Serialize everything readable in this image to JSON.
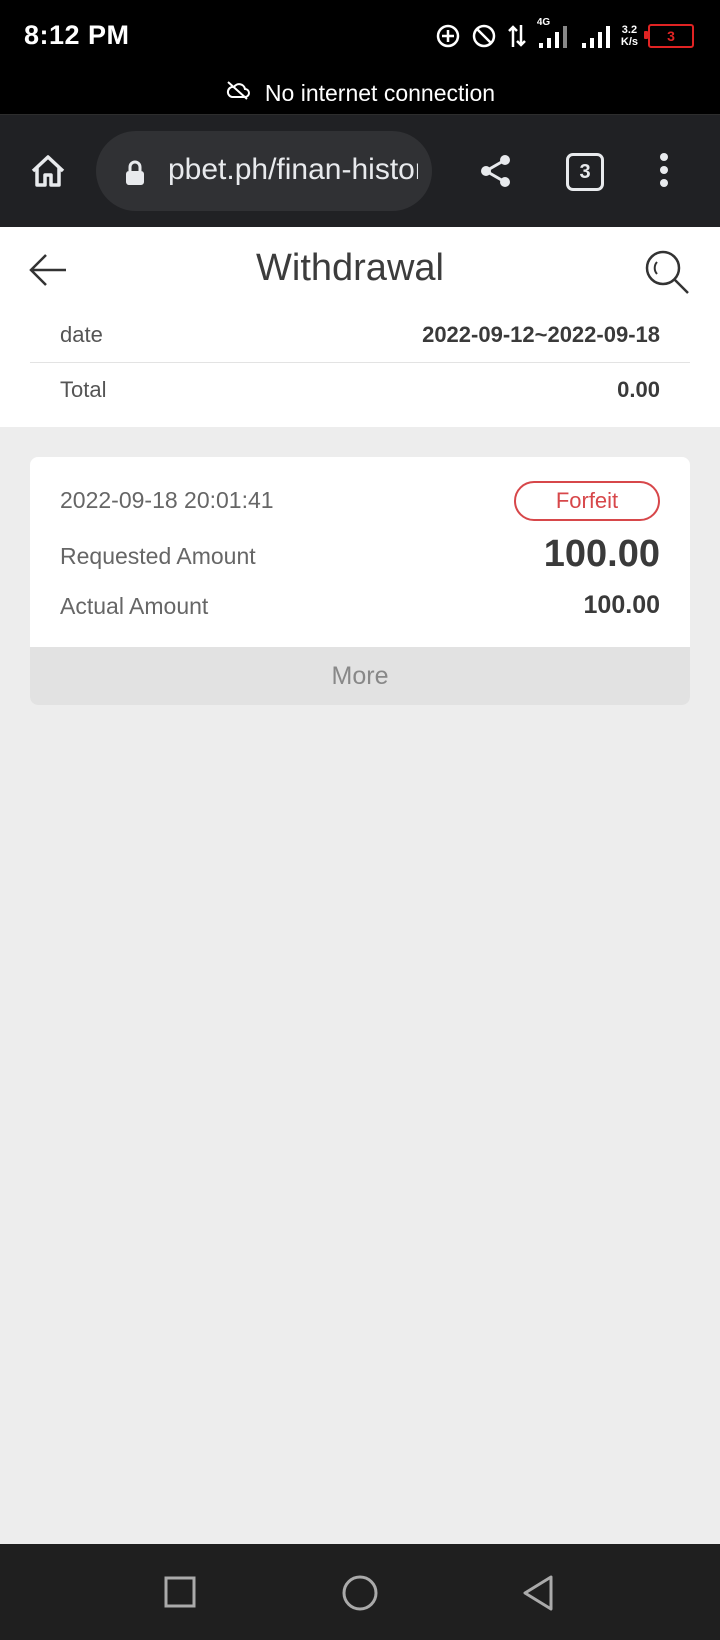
{
  "status_bar": {
    "time": "8:12 PM",
    "network_type": "4G",
    "net_speed_value": "3.2",
    "net_speed_unit": "K/s",
    "battery_level": "3",
    "icons": [
      "data-saver-icon",
      "do-not-disturb-icon",
      "data-transfer-icon",
      "signal-icon",
      "signal-icon",
      "battery-icon"
    ]
  },
  "offline_banner": {
    "text": "No internet connection",
    "icon": "cloud-off-icon"
  },
  "browser": {
    "url": "pbet.ph/finan-history",
    "tab_count": "3",
    "icons": [
      "home-icon",
      "lock-icon",
      "share-icon",
      "tabs-icon",
      "more-vert-icon"
    ]
  },
  "page": {
    "title": "Withdrawal",
    "summary": {
      "date_label": "date",
      "date_value": "2022-09-12~2022-09-18",
      "total_label": "Total",
      "total_value": "0.00"
    },
    "records": [
      {
        "datetime": "2022-09-18 20:01:41",
        "status": "Forfeit",
        "requested_label": "Requested Amount",
        "requested_value": "100.00",
        "actual_label": "Actual Amount",
        "actual_value": "100.00",
        "more_label": "More"
      }
    ]
  },
  "colors": {
    "status_red": "#d7474a",
    "battery_red": "#e02323",
    "browser_bar": "#202124",
    "page_bg": "#ededed"
  }
}
